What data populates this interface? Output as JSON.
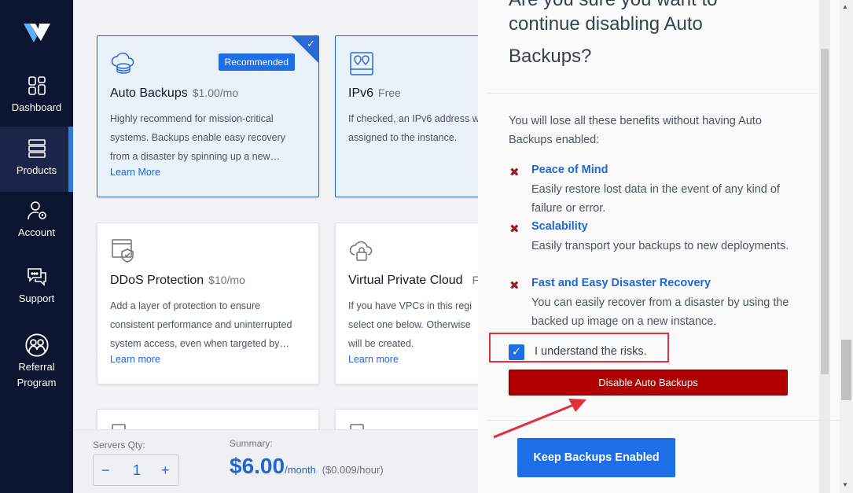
{
  "sidebar": {
    "items": [
      {
        "label": "Dashboard",
        "icon": "dashboard-icon"
      },
      {
        "label": "Products",
        "icon": "products-icon"
      },
      {
        "label": "Account",
        "icon": "account-icon"
      },
      {
        "label": "Support",
        "icon": "support-icon"
      },
      {
        "label": "Referral",
        "label2": "Program",
        "icon": "referral-icon"
      }
    ]
  },
  "cards": {
    "auto_backups": {
      "title": "Auto Backups",
      "price": "$1.00/mo",
      "badge": "Recommended",
      "desc": "Highly recommend for mission-critical systems. Backups enable easy recovery from a disaster by spinning up a new…",
      "link": "Learn More"
    },
    "ipv6": {
      "title": "IPv6",
      "price": "Free",
      "desc": "If checked, an IPv6 address w assigned to the instance."
    },
    "ddos": {
      "title": "DDoS Protection",
      "price": "$10/mo",
      "desc": "Add a layer of protection to ensure consistent performance and uninterrupted system access, even when targeted by…",
      "link": "Learn more"
    },
    "vpc": {
      "title": "Virtual Private Cloud",
      "price": "F",
      "desc": "If you have VPCs in this regi select one below. Otherwise will be created.",
      "link": "Learn more"
    }
  },
  "bottom": {
    "qty_label": "Servers Qty:",
    "minus": "−",
    "qty": "1",
    "plus": "+",
    "summary_label": "Summary:",
    "price": "$6.00",
    "per_month": "/month",
    "per_hour": "($0.009/hour)"
  },
  "dialog": {
    "heading_partial": "Are you sure you want to",
    "heading_line1": "continue disabling Auto",
    "heading_line2": "Backups?",
    "intro": "You will lose all these benefits without having Auto Backups enabled:",
    "benefits": [
      {
        "title": "Peace of Mind",
        "desc": "Easily restore lost data in the event of any kind of failure or error."
      },
      {
        "title": "Scalability",
        "desc": "Easily transport your backups to new deployments."
      },
      {
        "title": "Fast and Easy Disaster Recovery",
        "desc": "You can easily recover from a disaster by using the backed up image on a new instance."
      }
    ],
    "x_mark": "✖",
    "checkbox_checked": true,
    "checkbox_mark": "✓",
    "risk_label": "I understand the risks.",
    "disable_button": "Disable Auto Backups",
    "keep_button": "Keep Backups Enabled"
  },
  "colors": {
    "sidebar_bg": "#0b1530",
    "accent_blue": "#1e6ee6",
    "danger_red": "#b00000",
    "annotation_red": "#e0303a"
  }
}
